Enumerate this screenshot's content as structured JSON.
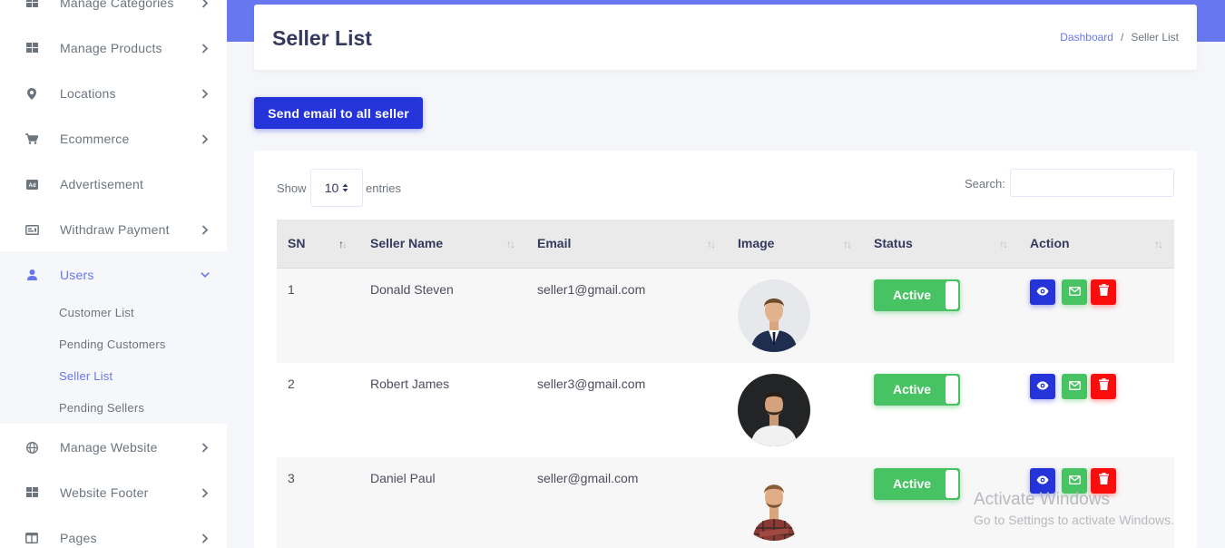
{
  "sidebar": {
    "items": [
      {
        "label": "Manage Categories",
        "icon": "grid-icon"
      },
      {
        "label": "Manage Products",
        "icon": "grid-icon"
      },
      {
        "label": "Locations",
        "icon": "map-pin-icon"
      },
      {
        "label": "Ecommerce",
        "icon": "cart-icon"
      },
      {
        "label": "Advertisement",
        "icon": "ad-icon"
      },
      {
        "label": "Withdraw Payment",
        "icon": "money-icon"
      },
      {
        "label": "Users",
        "icon": "user-icon"
      },
      {
        "label": "Manage Website",
        "icon": "globe-icon"
      },
      {
        "label": "Website Footer",
        "icon": "grid-icon"
      },
      {
        "label": "Pages",
        "icon": "columns-icon"
      }
    ],
    "users_submenu": [
      "Customer List",
      "Pending Customers",
      "Seller List",
      "Pending Sellers"
    ],
    "active_item": "Users",
    "active_subitem": "Seller List"
  },
  "header": {
    "title": "Seller List",
    "breadcrumb": [
      "Dashboard",
      "/",
      "Seller List"
    ]
  },
  "actions": {
    "email_all_label": "Send email to all seller"
  },
  "table_controls": {
    "show_label": "Show",
    "entries_value": "10",
    "entries_label": "entries",
    "search_label": "Search:"
  },
  "table": {
    "columns": [
      "SN",
      "Seller Name",
      "Email",
      "Image",
      "Status",
      "Action"
    ],
    "rows": [
      {
        "sn": "1",
        "name": "Donald Steven",
        "email": "seller1@gmail.com",
        "status": "Active"
      },
      {
        "sn": "2",
        "name": "Robert James",
        "email": "seller3@gmail.com",
        "status": "Active"
      },
      {
        "sn": "3",
        "name": "Daniel Paul",
        "email": "seller@gmail.com",
        "status": "Active"
      }
    ]
  },
  "watermark": {
    "line1": "Activate Windows",
    "line2": "Go to Settings to activate Windows."
  },
  "colors": {
    "primary": "#6777ef",
    "button_blue": "#2534d8",
    "success": "#47c363",
    "danger": "#fc0d0d"
  }
}
